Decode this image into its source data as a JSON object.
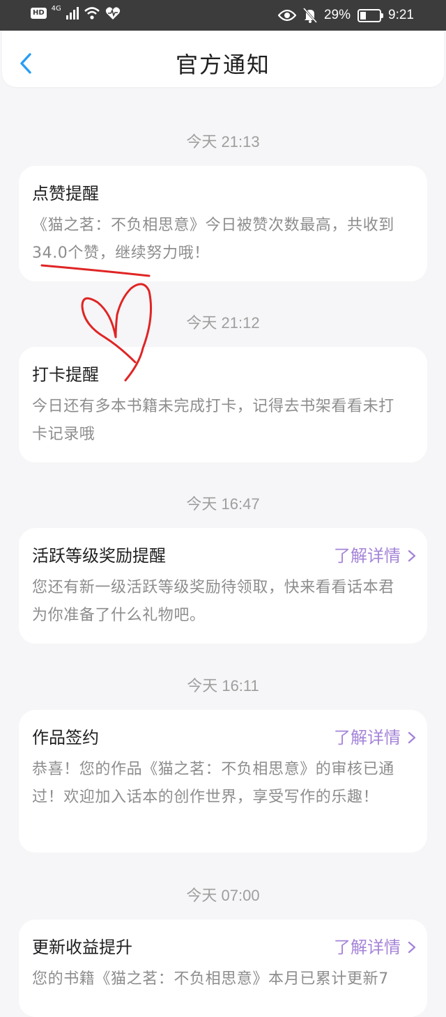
{
  "status_bar": {
    "network_label": "HD",
    "signal_label": "4G",
    "battery_percent": "29%",
    "time": "9:21",
    "icons": [
      "signal-icon",
      "wifi-icon",
      "health-icon",
      "eye-icon",
      "bell-off-icon",
      "battery-icon"
    ]
  },
  "nav": {
    "title": "官方通知",
    "back_icon": "chevron-left-icon",
    "accent": "#2a9df4"
  },
  "link_color": "#a584d8",
  "notifications": [
    {
      "time": "今天 21:13",
      "title": "点赞提醒",
      "body": "《猫之茗：不负相思意》今日被赞次数最高，共收到34.0个赞，继续努力哦！"
    },
    {
      "time": "今天 21:12",
      "title": "打卡提醒",
      "body": "今日还有多本书籍未完成打卡，记得去书架看看未打卡记录哦"
    },
    {
      "time": "今天 16:47",
      "title": "活跃等级奖励提醒",
      "link": "了解详情",
      "body": "您还有新一级活跃等级奖励待领取，快来看看话本君为你准备了什么礼物吧。"
    },
    {
      "time": "今天 16:11",
      "title": "作品签约",
      "link": "了解详情",
      "body": "恭喜！您的作品《猫之茗：不负相思意》的审核已通过！欢迎加入话本的创作世界，享受写作的乐趣！"
    },
    {
      "time": "今天 07:00",
      "title": "更新收益提升",
      "link": "了解详情",
      "body": "您的书籍《猫之茗：不负相思意》本月已累计更新7"
    }
  ]
}
